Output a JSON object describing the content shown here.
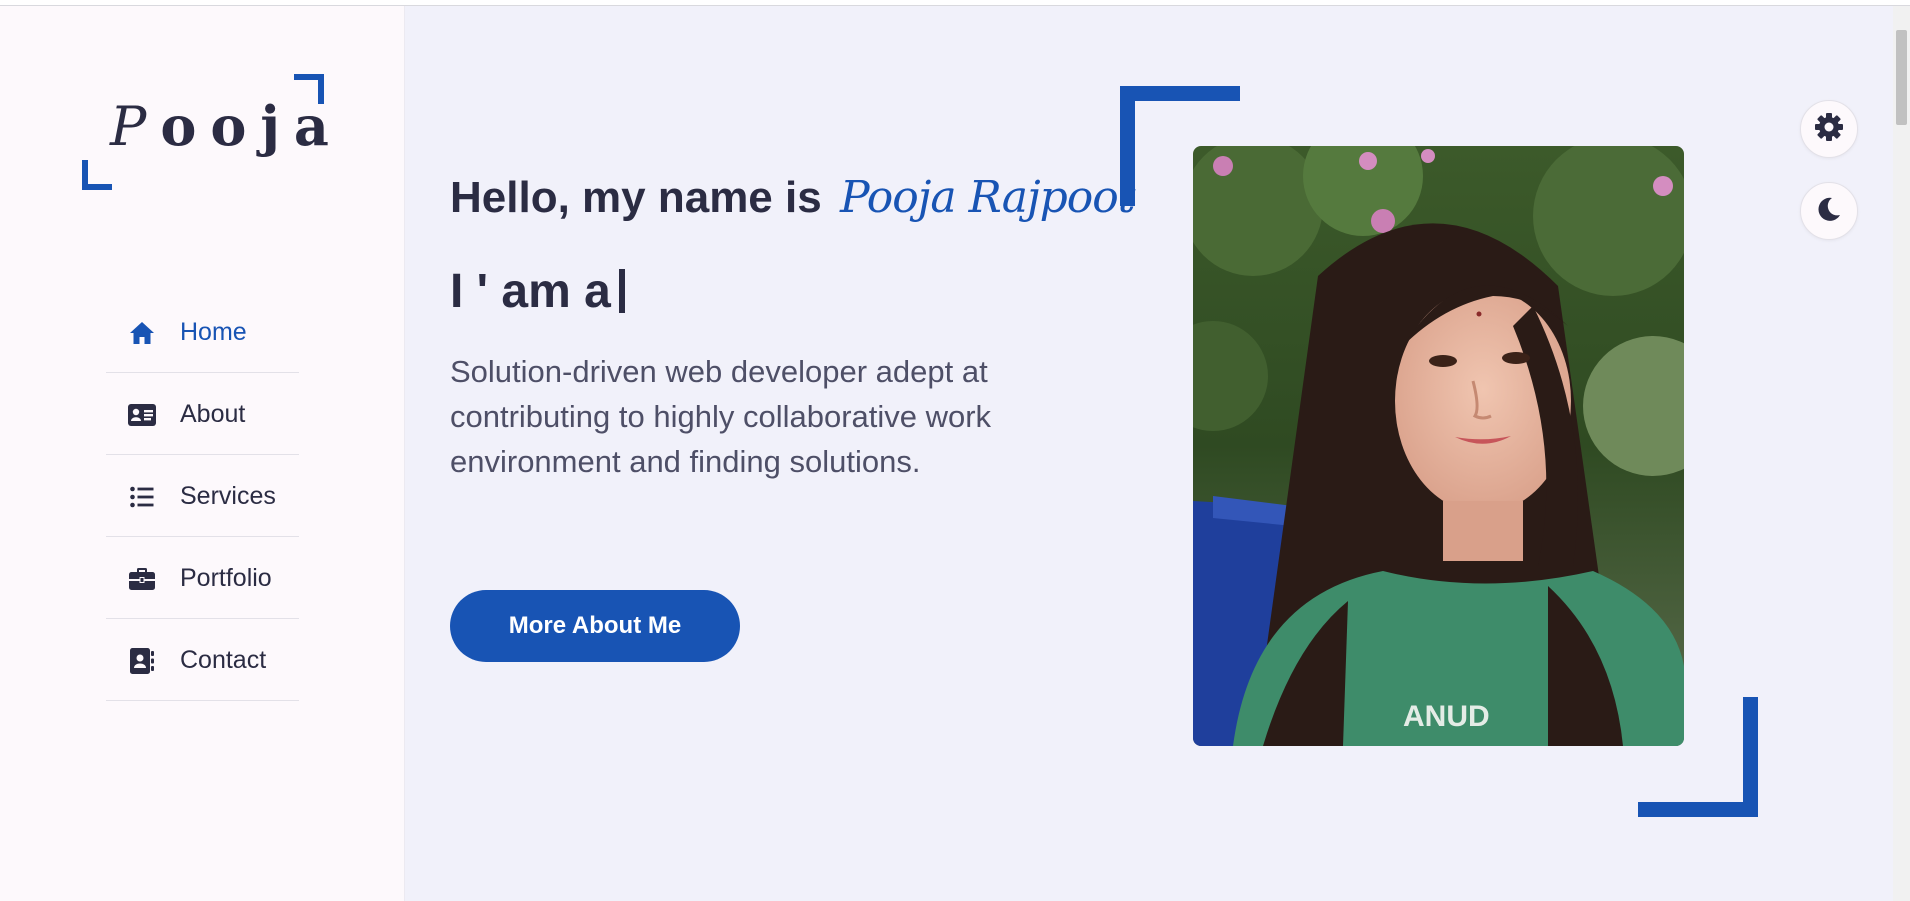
{
  "logo": {
    "text_first": "P",
    "text_rest": "ooja"
  },
  "nav": {
    "items": [
      {
        "label": "Home",
        "icon": "home-icon",
        "active": true
      },
      {
        "label": "About",
        "icon": "id-card-icon",
        "active": false
      },
      {
        "label": "Services",
        "icon": "list-icon",
        "active": false
      },
      {
        "label": "Portfolio",
        "icon": "briefcase-icon",
        "active": false
      },
      {
        "label": "Contact",
        "icon": "contact-book-icon",
        "active": false
      }
    ]
  },
  "hero": {
    "greeting": "Hello, my name is",
    "name": "Pooja Rajpoot",
    "typing_prefix": "I ' am a",
    "description": "Solution-driven web developer adept at contributing to highly collaborative work environment and finding solutions.",
    "button_label": "More About Me"
  },
  "controls": {
    "settings_icon": "gear-icon",
    "theme_icon": "moon-icon"
  },
  "colors": {
    "accent": "#1854b4",
    "text": "#2b2c43",
    "background": "#f1f1fa",
    "sidebar_background": "#fdf9fc"
  }
}
